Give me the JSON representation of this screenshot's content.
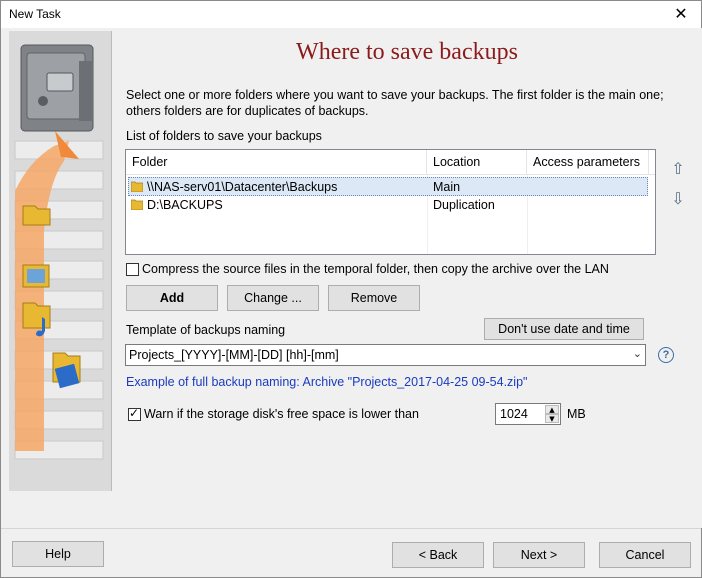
{
  "window": {
    "title": "New Task",
    "close_glyph": "✕"
  },
  "page": {
    "heading": "Where to save backups",
    "description": "Select one or more folders where you want to save your backups. The first folder is the main one; others folders are for duplicates of backups.",
    "list_label": "List of folders to save your backups"
  },
  "folders": {
    "columns": [
      "Folder",
      "Location",
      "Access parameters"
    ],
    "rows": [
      {
        "folder": "\\\\NAS-serv01\\Datacenter\\Backups",
        "location": "Main",
        "access": ""
      },
      {
        "folder": "D:\\BACKUPS",
        "location": "Duplication",
        "access": ""
      }
    ],
    "selected_index": 0,
    "move_up_icon": "arrow-up-icon",
    "move_down_icon": "arrow-down-icon"
  },
  "compress": {
    "label": "Compress the source files in the temporal folder, then copy the archive over the LAN",
    "checked": false
  },
  "buttons": {
    "add": "Add",
    "change": "Change ...",
    "remove": "Remove",
    "no_date": "Don't use date and time",
    "help": "Help",
    "back": "< Back",
    "next": "Next >",
    "cancel": "Cancel"
  },
  "template": {
    "label": "Template of backups naming",
    "value": "Projects_[YYYY]-[MM]-[DD] [hh]-[mm]",
    "example": "Example of full backup naming: Archive \"Projects_2017-04-25 09-54.zip\""
  },
  "warn": {
    "label": "Warn if the storage disk's free space is lower than",
    "checked": true,
    "value": "1024",
    "unit": "MB"
  },
  "colors": {
    "heading": "#8b1a1a",
    "example_link": "#1a3bbf",
    "selection": "#dce8f5"
  }
}
